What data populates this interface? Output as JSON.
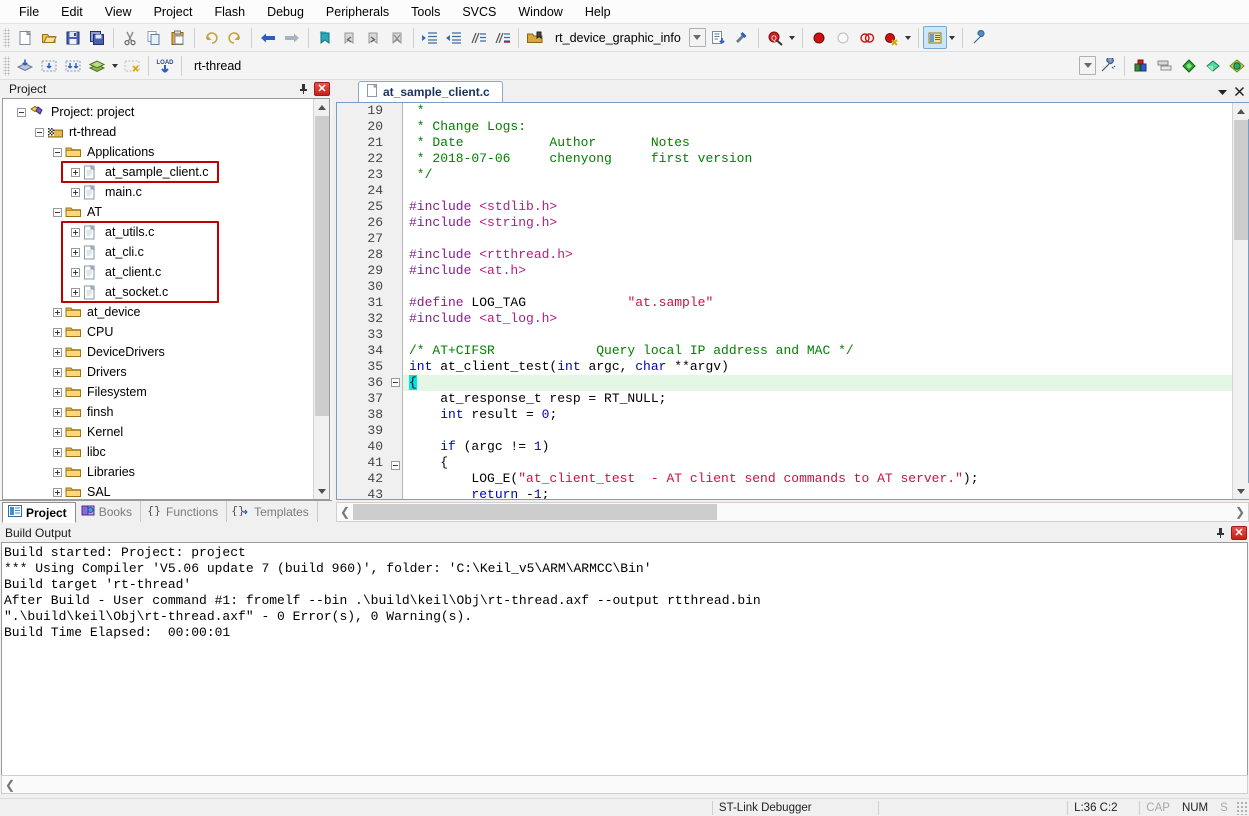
{
  "menu": {
    "items": [
      "File",
      "Edit",
      "View",
      "Project",
      "Flash",
      "Debug",
      "Peripherals",
      "Tools",
      "SVCS",
      "Window",
      "Help"
    ]
  },
  "toolbar_main": {
    "buttons": [
      "new-file-icon",
      "open-file-icon",
      "save-icon",
      "save-all-icon",
      "cut-icon",
      "copy-icon",
      "paste-icon",
      "undo-icon",
      "redo-icon",
      "navigate-back-icon",
      "navigate-forward-icon",
      "bookmark-toggle-icon",
      "bookmark-prev-icon",
      "bookmark-next-icon",
      "bookmark-clear-icon",
      "indent-right-icon",
      "indent-left-icon",
      "comment-icon",
      "uncomment-icon"
    ],
    "bookmark_value": "rt_device_graphic_info",
    "after_combo": [
      "insert-file-icon",
      "debug-settings-icon"
    ],
    "find_icon": "find-in-files-icon",
    "breakpoint_icons": [
      "insert-breakpoint-icon",
      "disable-breakpoint-icon",
      "remove-all-breakpoints-icon",
      "disable-all-breakpoints-icon"
    ],
    "window_icon": "window-layout-icon",
    "config_icon": "configure-icon"
  },
  "toolbar_build": {
    "buttons": [
      "translate-icon",
      "build-icon",
      "rebuild-icon",
      "batch-build-icon",
      "stop-build-icon",
      "download-icon"
    ],
    "target_value": "rt-thread",
    "after_buttons": [
      "target-options-icon",
      "manage-runtime-icon",
      "multi-project-icon",
      "components-icon",
      "pack-installer-icon",
      "manage-project-icon"
    ]
  },
  "project_panel": {
    "title": "Project",
    "pin_icon": "pin-icon",
    "close_icon": "close-icon",
    "tabs": [
      {
        "label": "Project",
        "icon": "project-icon",
        "active": true
      },
      {
        "label": "Books",
        "icon": "books-icon",
        "active": false
      },
      {
        "label": "Functions",
        "icon": "functions-icon",
        "active": false
      },
      {
        "label": "Templates",
        "icon": "templates-icon",
        "active": false
      }
    ],
    "tree": [
      {
        "label": "Project: project",
        "indent": 0,
        "icon": "project-root-icon",
        "expander": "minus",
        "highlight": false
      },
      {
        "label": "rt-thread",
        "indent": 1,
        "icon": "target-icon",
        "expander": "minus",
        "highlight": false
      },
      {
        "label": "Applications",
        "indent": 2,
        "icon": "folder-icon",
        "expander": "minus",
        "highlight": false
      },
      {
        "label": "at_sample_client.c",
        "indent": 3,
        "icon": "c-file-icon",
        "expander": "plus",
        "highlight": true
      },
      {
        "label": "main.c",
        "indent": 3,
        "icon": "c-file-icon",
        "expander": "plus",
        "highlight": false
      },
      {
        "label": "AT",
        "indent": 2,
        "icon": "folder-icon",
        "expander": "minus",
        "highlight": false
      },
      {
        "label": "at_utils.c",
        "indent": 3,
        "icon": "c-file-icon",
        "expander": "plus",
        "highlight": true
      },
      {
        "label": "at_cli.c",
        "indent": 3,
        "icon": "c-file-icon",
        "expander": "plus",
        "highlight": true
      },
      {
        "label": "at_client.c",
        "indent": 3,
        "icon": "c-file-icon",
        "expander": "plus",
        "highlight": true
      },
      {
        "label": "at_socket.c",
        "indent": 3,
        "icon": "c-file-icon",
        "expander": "plus",
        "highlight": true
      },
      {
        "label": "at_device",
        "indent": 2,
        "icon": "folder-icon",
        "expander": "plus",
        "highlight": false
      },
      {
        "label": "CPU",
        "indent": 2,
        "icon": "folder-icon",
        "expander": "plus",
        "highlight": false
      },
      {
        "label": "DeviceDrivers",
        "indent": 2,
        "icon": "folder-icon",
        "expander": "plus",
        "highlight": false
      },
      {
        "label": "Drivers",
        "indent": 2,
        "icon": "folder-icon",
        "expander": "plus",
        "highlight": false
      },
      {
        "label": "Filesystem",
        "indent": 2,
        "icon": "folder-icon",
        "expander": "plus",
        "highlight": false
      },
      {
        "label": "finsh",
        "indent": 2,
        "icon": "folder-icon",
        "expander": "plus",
        "highlight": false
      },
      {
        "label": "Kernel",
        "indent": 2,
        "icon": "folder-icon",
        "expander": "plus",
        "highlight": false
      },
      {
        "label": "libc",
        "indent": 2,
        "icon": "folder-icon",
        "expander": "plus",
        "highlight": false
      },
      {
        "label": "Libraries",
        "indent": 2,
        "icon": "folder-icon",
        "expander": "plus",
        "highlight": false
      },
      {
        "label": "SAL",
        "indent": 2,
        "icon": "folder-icon",
        "expander": "plus",
        "highlight": false
      }
    ]
  },
  "editor": {
    "tab_label": "at_sample_client.c",
    "tab_icon": "c-file-icon",
    "dropdown_icon": "chevron-down-icon",
    "close_icon": "close-icon",
    "first_line": 19,
    "cursor_line": 36,
    "lines": [
      {
        "n": 19,
        "tokens": [
          {
            "t": " * ",
            "c": "cm"
          }
        ]
      },
      {
        "n": 20,
        "tokens": [
          {
            "t": " * Change Logs:",
            "c": "cm"
          }
        ]
      },
      {
        "n": 21,
        "tokens": [
          {
            "t": " * Date           Author       Notes",
            "c": "cm"
          }
        ]
      },
      {
        "n": 22,
        "tokens": [
          {
            "t": " * 2018-07-06     chenyong     first version",
            "c": "cm"
          }
        ]
      },
      {
        "n": 23,
        "tokens": [
          {
            "t": " */",
            "c": "cm"
          }
        ]
      },
      {
        "n": 24,
        "tokens": []
      },
      {
        "n": 25,
        "tokens": [
          {
            "t": "#include ",
            "c": "pp"
          },
          {
            "t": "<stdlib.h>",
            "c": "hdr"
          }
        ]
      },
      {
        "n": 26,
        "tokens": [
          {
            "t": "#include ",
            "c": "pp"
          },
          {
            "t": "<string.h>",
            "c": "hdr"
          }
        ]
      },
      {
        "n": 27,
        "tokens": []
      },
      {
        "n": 28,
        "tokens": [
          {
            "t": "#include ",
            "c": "pp"
          },
          {
            "t": "<rtthread.h>",
            "c": "hdr"
          }
        ]
      },
      {
        "n": 29,
        "tokens": [
          {
            "t": "#include ",
            "c": "pp"
          },
          {
            "t": "<at.h>",
            "c": "hdr"
          }
        ]
      },
      {
        "n": 30,
        "tokens": []
      },
      {
        "n": 31,
        "tokens": [
          {
            "t": "#define ",
            "c": "pp"
          },
          {
            "t": "LOG_TAG             ",
            "c": ""
          },
          {
            "t": "\"at.sample\"",
            "c": "str"
          }
        ]
      },
      {
        "n": 32,
        "tokens": [
          {
            "t": "#include ",
            "c": "pp"
          },
          {
            "t": "<at_log.h>",
            "c": "hdr"
          }
        ]
      },
      {
        "n": 33,
        "tokens": []
      },
      {
        "n": 34,
        "tokens": [
          {
            "t": "/* AT+CIFSR             Query local IP address and MAC */",
            "c": "cm"
          }
        ]
      },
      {
        "n": 35,
        "tokens": [
          {
            "t": "int",
            "c": "kw"
          },
          {
            "t": " at_client_test(",
            "c": ""
          },
          {
            "t": "int",
            "c": "kw"
          },
          {
            "t": " argc, ",
            "c": ""
          },
          {
            "t": "char",
            "c": "kw"
          },
          {
            "t": " **argv)",
            "c": ""
          }
        ]
      },
      {
        "n": 36,
        "tokens": [
          {
            "t": "{",
            "c": "selbrace"
          }
        ],
        "fold": true,
        "cursor": true
      },
      {
        "n": 37,
        "tokens": [
          {
            "t": "    at_response_t resp = RT_NULL;",
            "c": ""
          }
        ]
      },
      {
        "n": 38,
        "tokens": [
          {
            "t": "    ",
            "c": ""
          },
          {
            "t": "int",
            "c": "kw"
          },
          {
            "t": " result = ",
            "c": ""
          },
          {
            "t": "0",
            "c": "num"
          },
          {
            "t": ";",
            "c": ""
          }
        ]
      },
      {
        "n": 39,
        "tokens": []
      },
      {
        "n": 40,
        "tokens": [
          {
            "t": "    ",
            "c": ""
          },
          {
            "t": "if",
            "c": "kw"
          },
          {
            "t": " (argc != ",
            "c": ""
          },
          {
            "t": "1",
            "c": "num"
          },
          {
            "t": ")",
            "c": ""
          }
        ]
      },
      {
        "n": 41,
        "tokens": [
          {
            "t": "    {",
            "c": ""
          }
        ],
        "fold": true
      },
      {
        "n": 42,
        "tokens": [
          {
            "t": "        LOG_E(",
            "c": ""
          },
          {
            "t": "\"at_client_test  - AT client send commands to AT server.\"",
            "c": "str"
          },
          {
            "t": ");",
            "c": ""
          }
        ]
      },
      {
        "n": 43,
        "tokens": [
          {
            "t": "        ",
            "c": ""
          },
          {
            "t": "return",
            "c": "kw"
          },
          {
            "t": " -",
            "c": ""
          },
          {
            "t": "1",
            "c": "num"
          },
          {
            "t": ";",
            "c": ""
          }
        ]
      }
    ]
  },
  "build_output": {
    "title": "Build Output",
    "pin_icon": "pin-icon",
    "close_icon": "close-icon",
    "lines": [
      "Build started: Project: project",
      "*** Using Compiler 'V5.06 update 7 (build 960)', folder: 'C:\\Keil_v5\\ARM\\ARMCC\\Bin'",
      "Build target 'rt-thread'",
      "After Build - User command #1: fromelf --bin .\\build\\keil\\Obj\\rt-thread.axf --output rtthread.bin",
      "\".\\build\\keil\\Obj\\rt-thread.axf\" - 0 Error(s), 0 Warning(s).",
      "Build Time Elapsed:  00:00:01"
    ]
  },
  "statusbar": {
    "debugger": "ST-Link Debugger",
    "position": "L:36 C:2",
    "cap": "CAP",
    "num": "NUM",
    "scrl": "S"
  },
  "colors": {
    "highlight_box": "#C00000",
    "comment": "#008000",
    "preprocessor": "#8c1a8c",
    "header": "#b02080",
    "string": "#d01040",
    "keyword": "#0000c8",
    "cursor_line": "#e4f7e4",
    "selection": "#00e5e5"
  }
}
